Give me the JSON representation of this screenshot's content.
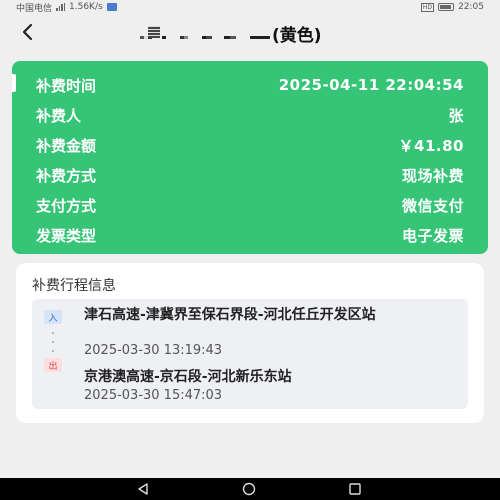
{
  "status_bar": {
    "carrier": "中国电信",
    "speed": "1.56K/s",
    "time": "22:05"
  },
  "header": {
    "title_suffix": "(黄色)",
    "back_icon": "chevron-left-icon"
  },
  "payment": {
    "rows": [
      {
        "label": "补费时间",
        "value": "2025-04-11 22:04:54"
      },
      {
        "label": "补费人",
        "value": "张"
      },
      {
        "label": "补费金额",
        "value": "￥41.80"
      },
      {
        "label": "补费方式",
        "value": "现场补费"
      },
      {
        "label": "支付方式",
        "value": "微信支付"
      },
      {
        "label": "发票类型",
        "value": "电子发票"
      }
    ],
    "card_color": "#36c477"
  },
  "trip": {
    "title": "补费行程信息",
    "entry": {
      "badge": "入",
      "name": "津石高速-津冀界至保石界段-河北任丘开发区站",
      "time": "2025-03-30 13:19:43"
    },
    "exit": {
      "badge": "出",
      "name": "京港澳高速-京石段-河北新乐东站",
      "time": "2025-03-30 15:47:03"
    }
  },
  "nav_bar": {
    "icons": [
      "back-triangle-icon",
      "home-circle-icon",
      "recent-square-icon"
    ]
  }
}
